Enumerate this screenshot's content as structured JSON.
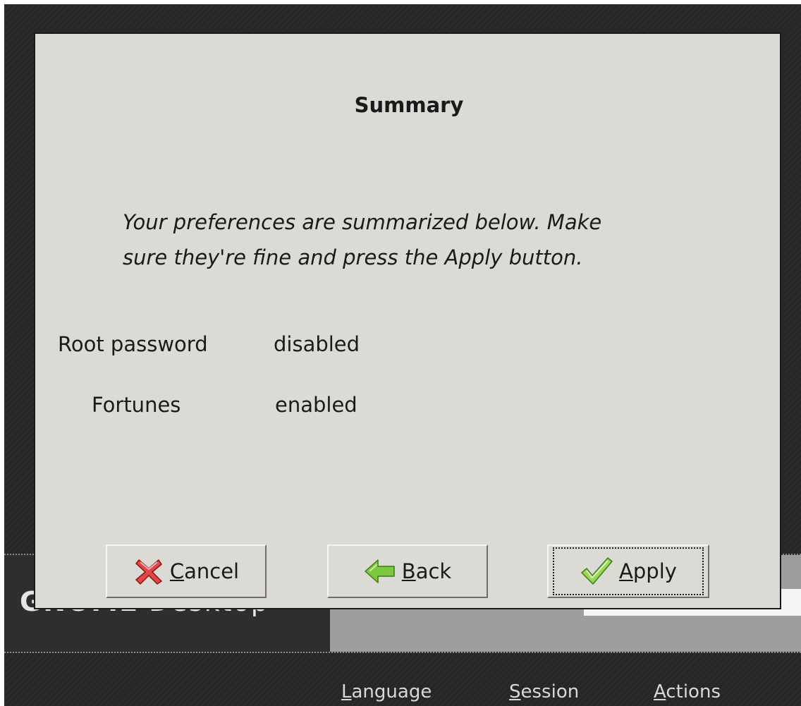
{
  "desktop": {
    "title_bold": "GNOME",
    "title_rest": " Desktop",
    "menu": [
      {
        "label": "Language",
        "mnemonic": "L",
        "rest": "anguage"
      },
      {
        "label": "Session",
        "mnemonic": "S",
        "rest": "ession"
      },
      {
        "label": "Actions",
        "mnemonic": "A",
        "rest": "ctions"
      }
    ]
  },
  "dialog": {
    "title": "Summary",
    "intro_line1": "Your preferences are summarized below. Make",
    "intro_line2": "sure they're fine and press the Apply button.",
    "rows": [
      {
        "label": "Root password",
        "value": "disabled"
      },
      {
        "label": "Fortunes",
        "value": "enabled"
      }
    ],
    "buttons": {
      "cancel": {
        "label": "Cancel",
        "mnemonic": "C",
        "rest": "ancel",
        "icon": "red-x-icon"
      },
      "back": {
        "label": "Back",
        "mnemonic": "B",
        "rest": "ack",
        "icon": "green-left-arrow-icon"
      },
      "apply": {
        "label": "Apply",
        "mnemonic": "A",
        "rest": "pply",
        "icon": "green-checkmark-icon"
      }
    }
  }
}
